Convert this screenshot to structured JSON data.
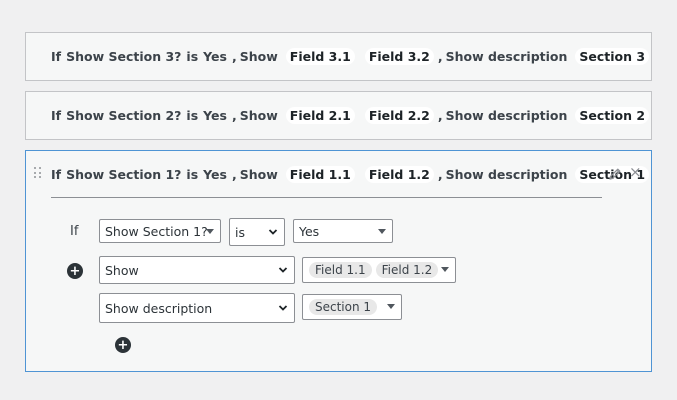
{
  "rules": [
    {
      "summary": {
        "if": "If",
        "condition_field": "Show Section 3?",
        "operator": "is",
        "value": "Yes",
        "sep": ",",
        "action1": "Show",
        "fields": [
          "Field 3.1",
          "Field 3.2"
        ],
        "action2": "Show description",
        "section": "Section 3"
      }
    },
    {
      "summary": {
        "if": "If",
        "condition_field": "Show Section 2?",
        "operator": "is",
        "value": "Yes",
        "sep": ",",
        "action1": "Show",
        "fields": [
          "Field 2.1",
          "Field 2.2"
        ],
        "action2": "Show description",
        "section": "Section 2"
      }
    },
    {
      "summary": {
        "if": "If",
        "condition_field": "Show Section 1?",
        "operator": "is",
        "value": "Yes",
        "sep": ",",
        "action1": "Show",
        "fields": [
          "Field 1.1",
          "Field 1.2"
        ],
        "action2": "Show description",
        "section": "Section 1"
      },
      "editor": {
        "if_label": "If",
        "condition_field": "Show Section 1?",
        "operator": "is",
        "value": "Yes",
        "actions": [
          {
            "action": "Show",
            "targets": [
              "Field 1.1",
              "Field 1.2"
            ]
          },
          {
            "action": "Show description",
            "targets": [
              "Section 1"
            ]
          }
        ]
      }
    }
  ],
  "icons": {
    "drag": "drag-handle-icon",
    "edit": "pencil-icon",
    "close": "close-icon",
    "add": "plus-circle-icon"
  },
  "glyphs": {
    "close": "×",
    "add": "+"
  }
}
